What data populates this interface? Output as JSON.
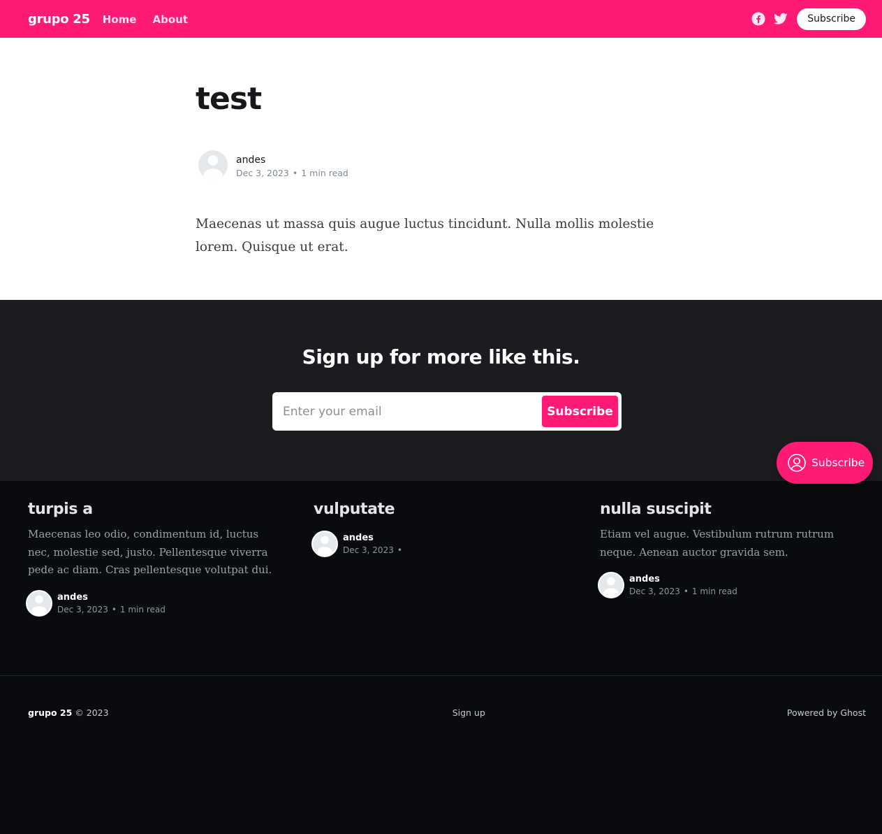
{
  "header": {
    "site_title": "grupo 25",
    "nav": [
      {
        "label": "Home"
      },
      {
        "label": "About"
      }
    ],
    "social_icons": [
      "facebook-icon",
      "twitter-icon"
    ],
    "subscribe_label": "Subscribe",
    "bg_color": "#ff1a75"
  },
  "article": {
    "title": "test",
    "author": "andes",
    "date": "Dec 3, 2023",
    "reading_time": "1 min read",
    "content": "Maecenas ut massa quis augue luctus tincidunt. Nulla mollis molestie lorem. Quisque ut erat."
  },
  "signup": {
    "heading": "Sign up for more like this.",
    "email_placeholder": "Enter your email",
    "button_label": "Subscribe"
  },
  "portal": {
    "label": "Subscribe"
  },
  "related_posts": [
    {
      "title": "turpis a",
      "excerpt": "Maecenas leo odio, condimentum id, luctus nec, molestie sed, justo. Pellentesque viverra pede ac diam. Cras pellentesque volutpat dui.",
      "author": "andes",
      "date": "Dec 3, 2023",
      "reading_time": "1 min read"
    },
    {
      "title": "vulputate",
      "excerpt": "",
      "author": "andes",
      "date": "Dec 3, 2023",
      "reading_time": ""
    },
    {
      "title": "nulla suscipit",
      "excerpt": "Etiam vel augue. Vestibulum rutrum rutrum neque. Aenean auctor gravida sem.",
      "author": "andes",
      "date": "Dec 3, 2023",
      "reading_time": "1 min read"
    }
  ],
  "footer": {
    "site_title": "grupo 25",
    "copyright": "© 2023",
    "signup_link": "Sign up",
    "powered_by": "Powered by Ghost"
  },
  "colors": {
    "accent": "#ff1a75",
    "dark_band": "#1b1c20",
    "footer_bg": "#0a0b0e"
  }
}
